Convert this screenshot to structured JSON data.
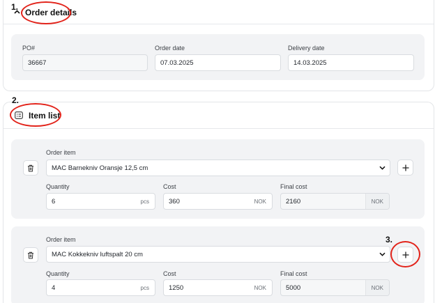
{
  "annotations": {
    "step1": "1.",
    "step2": "2.",
    "step3": "3."
  },
  "order_details": {
    "title": "Order details",
    "collapse_icon": "chevron-up-icon",
    "po_label": "PO#",
    "po_value": "36667",
    "order_date_label": "Order date",
    "order_date_value": "07.03.2025",
    "delivery_date_label": "Delivery date",
    "delivery_date_value": "14.03.2025"
  },
  "item_list": {
    "title": "Item list",
    "icon": "list-icon",
    "items": [
      {
        "order_item_label": "Order item",
        "order_item_value": "MAC Barnekniv Oransje 12,5 cm",
        "quantity_label": "Quantity",
        "quantity_value": "6",
        "quantity_unit": "pcs",
        "cost_label": "Cost",
        "cost_value": "360",
        "cost_unit": "NOK",
        "final_cost_label": "Final cost",
        "final_cost_value": "2160",
        "final_cost_unit": "NOK"
      },
      {
        "order_item_label": "Order item",
        "order_item_value": "MAC Kokkekniv luftspalt 20 cm",
        "quantity_label": "Quantity",
        "quantity_value": "4",
        "quantity_unit": "pcs",
        "cost_label": "Cost",
        "cost_value": "1250",
        "cost_unit": "NOK",
        "final_cost_label": "Final cost",
        "final_cost_value": "5000",
        "final_cost_unit": "NOK"
      }
    ]
  },
  "colors": {
    "annotation_red": "#e2231a",
    "panel_bg": "#f2f3f5",
    "border": "#d9dce0"
  }
}
